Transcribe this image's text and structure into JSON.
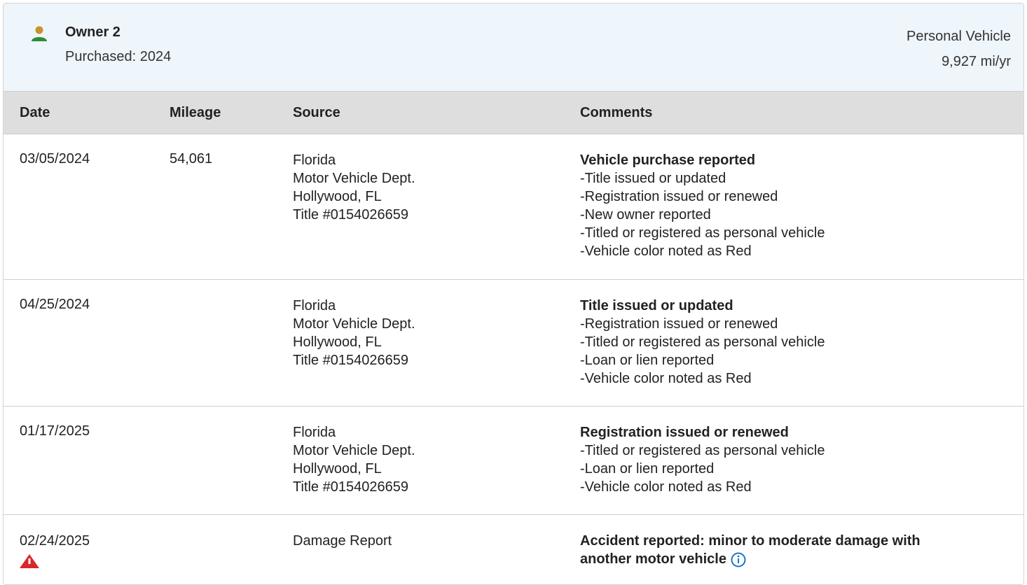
{
  "owner": {
    "name": "Owner 2",
    "purchased": "Purchased: 2024",
    "vehicle_type": "Personal Vehicle",
    "mileage_rate": "9,927 mi/yr",
    "icon": "person-icon"
  },
  "columns": {
    "date": "Date",
    "mileage": "Mileage",
    "source": "Source",
    "comments": "Comments"
  },
  "rows": [
    {
      "date": "03/05/2024",
      "mileage": "54,061",
      "source": [
        "Florida",
        "Motor Vehicle Dept.",
        "Hollywood, FL",
        "Title #0154026659"
      ],
      "comment_title": "Vehicle purchase reported",
      "comment_items": [
        "Title issued or updated",
        "Registration issued or renewed",
        "New owner reported",
        "Titled or registered as personal vehicle",
        "Vehicle color noted as Red"
      ]
    },
    {
      "date": "04/25/2024",
      "mileage": "",
      "source": [
        "Florida",
        "Motor Vehicle Dept.",
        "Hollywood, FL",
        "Title #0154026659"
      ],
      "comment_title": "Title issued or updated",
      "comment_items": [
        "Registration issued or renewed",
        "Titled or registered as personal vehicle",
        "Loan or lien reported",
        "Vehicle color noted as Red"
      ]
    },
    {
      "date": "01/17/2025",
      "mileage": "",
      "source": [
        "Florida",
        "Motor Vehicle Dept.",
        "Hollywood, FL",
        "Title #0154026659"
      ],
      "comment_title": "Registration issued or renewed",
      "comment_items": [
        "Titled or registered as personal vehicle",
        "Loan or lien reported",
        "Vehicle color noted as Red"
      ]
    },
    {
      "date": "02/24/2025",
      "mileage": "",
      "source": [
        "Damage Report"
      ],
      "comment_title_line1": "Accident reported: minor to moderate damage with",
      "comment_title_line2": "another motor vehicle",
      "icons": [
        "alert-icon",
        "info-icon"
      ]
    }
  ],
  "colors": {
    "header_bg": "#eef5fb",
    "table_header_bg": "#dedede",
    "alert": "#d9262b",
    "info": "#1a73c9",
    "person_head": "#c8942a",
    "person_body": "#2e8b3a"
  }
}
